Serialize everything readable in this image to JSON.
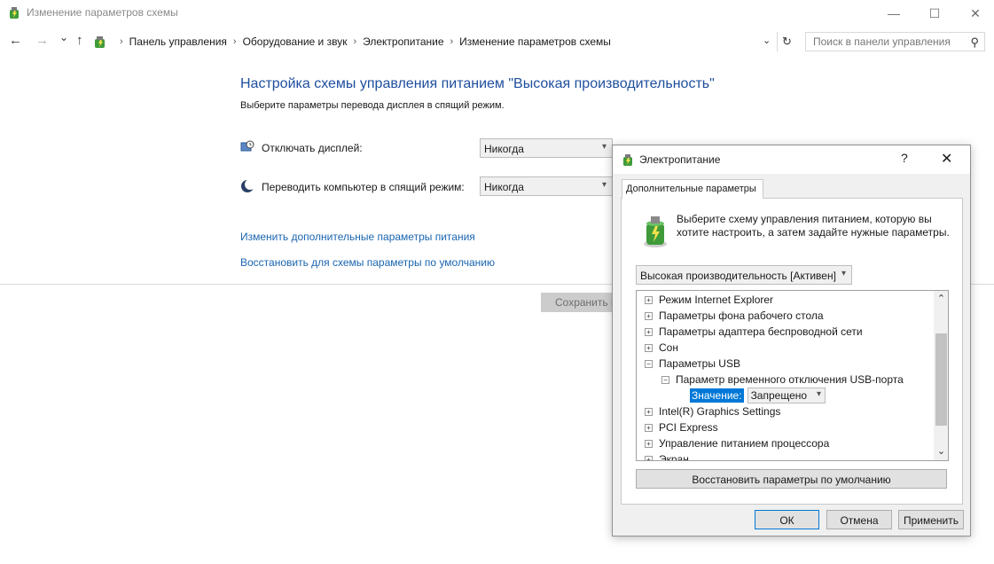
{
  "window": {
    "title": "Изменение параметров схемы",
    "min_glyph": "—",
    "max_glyph": "☐",
    "close_glyph": "✕"
  },
  "nav": {
    "back_glyph": "←",
    "forward_glyph": "→",
    "recent_glyph": "⌄",
    "up_glyph": "↑",
    "breadcrumb": [
      "Панель управления",
      "Оборудование и звук",
      "Электропитание",
      "Изменение параметров схемы"
    ],
    "separator": "›",
    "dropdown_glyph": "⌄",
    "refresh_glyph": "↻",
    "search_placeholder": "Поиск в панели управления",
    "search_glyph": "⚲"
  },
  "main": {
    "title": "Настройка схемы управления питанием \"Высокая производительность\"",
    "subtitle": "Выберите параметры перевода дисплея в спящий режим.",
    "display_off_label": "Отключать дисплей:",
    "display_off_value": "Никогда",
    "sleep_label": "Переводить компьютер в спящий режим:",
    "sleep_value": "Никогда",
    "link_advanced": "Изменить дополнительные параметры питания",
    "link_restore": "Восстановить для схемы параметры по умолчанию",
    "save_button": "Сохранить изменения"
  },
  "dialog": {
    "title": "Электропитание",
    "help_glyph": "?",
    "close_glyph": "✕",
    "tab_label": "Дополнительные параметры",
    "description": "Выберите схему управления питанием, которую вы хотите настроить, а затем задайте нужные параметры.",
    "scheme_value": "Высокая производительность [Активен]",
    "tree": [
      {
        "label": "Режим Internet Explorer",
        "sign": "+"
      },
      {
        "label": "Параметры фона рабочего стола",
        "sign": "+"
      },
      {
        "label": "Параметры адаптера беспроводной сети",
        "sign": "+"
      },
      {
        "label": "Сон",
        "sign": "+"
      },
      {
        "label": "Параметры USB",
        "sign": "−"
      },
      {
        "label": "Параметр временного отключения USB-порта",
        "sign": "−"
      },
      {
        "label": "Intel(R) Graphics Settings",
        "sign": "+"
      },
      {
        "label": "PCI Express",
        "sign": "+"
      },
      {
        "label": "Управление питанием процессора",
        "sign": "+"
      },
      {
        "label": "Экран",
        "sign": "+"
      }
    ],
    "value_label": "Значение:",
    "value_selected": "Запрещено",
    "restore_button": "Восстановить параметры по умолчанию",
    "ok_button": "ОК",
    "cancel_button": "Отмена",
    "apply_button": "Применить"
  },
  "colors": {
    "title_blue": "#1e4e9e",
    "link_blue": "#1a65b0",
    "selection": "#0078d7"
  }
}
